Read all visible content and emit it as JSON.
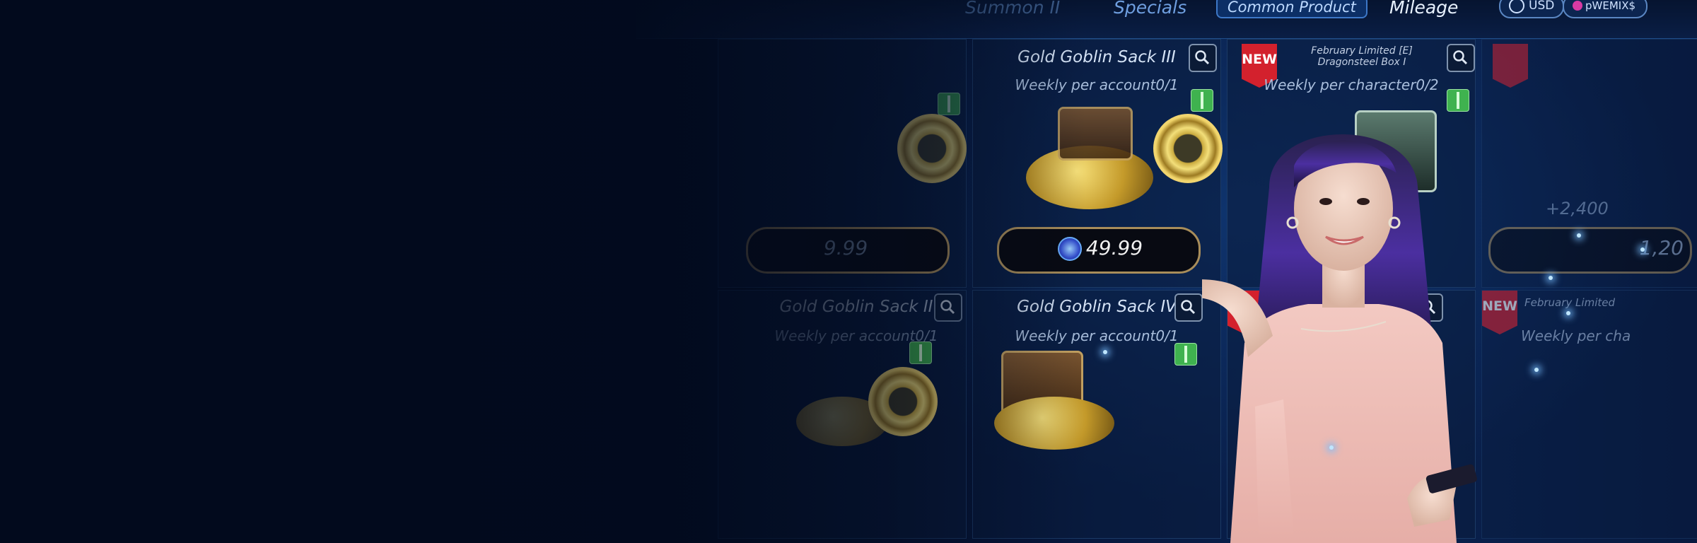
{
  "top_nav": {
    "tabs": [
      {
        "label": "Summon II"
      },
      {
        "label": "Specials"
      },
      {
        "label": "Common Product",
        "selected": true
      },
      {
        "label": "Mileage"
      }
    ],
    "currency": "USD",
    "account": "pWEMIX$"
  },
  "products": [
    {
      "name": "Gold Goblin Sack III",
      "limit": "Weekly per account0/1",
      "price": "49.99"
    },
    {
      "name": "February Limited [E] Dragonsteel Box I",
      "limit": "Weekly per character0/2",
      "badge": "NEW"
    },
    {
      "name": "Gold Goblin Sack II",
      "limit": "Weekly per account0/1",
      "price": "9.99"
    },
    {
      "name": "Gold Goblin Sack IV",
      "limit": "Weekly per account0/1"
    },
    {
      "name": "February Limited",
      "limit": "Weekly per cha",
      "badge": "NEW"
    }
  ],
  "partial_price": "1,20",
  "partial_bonus": "+2,400",
  "colors": {
    "accent": "#3d78c8",
    "background": "#020a1d",
    "badge": "#d3212d",
    "frame_gold": "#a88d5a"
  }
}
